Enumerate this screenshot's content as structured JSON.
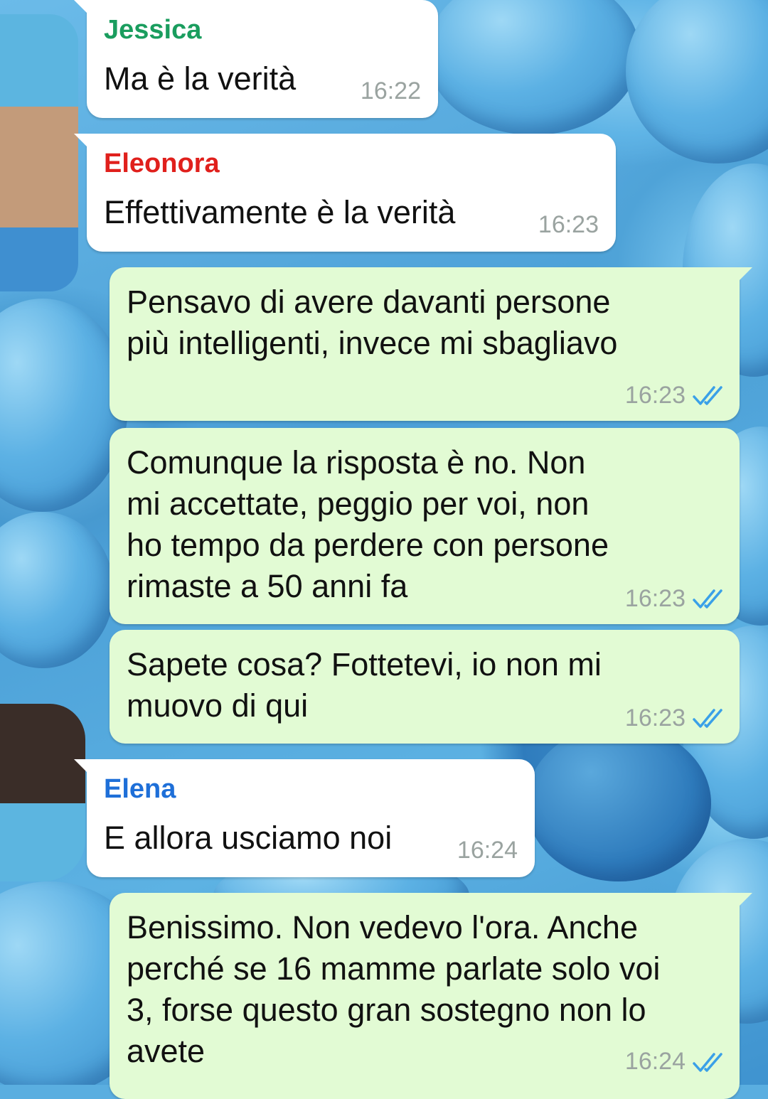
{
  "colors": {
    "incoming_bubble": "#ffffff",
    "outgoing_bubble": "#e2fbd4",
    "read_ticks": "#3aa0e8",
    "jessica": "#1a9d5e",
    "eleonora": "#e0201c",
    "elena": "#1e6fd8"
  },
  "messages": [
    {
      "direction": "incoming",
      "sender": "Jessica",
      "lines": [
        "Ma è la verità"
      ],
      "time": "16:22"
    },
    {
      "direction": "incoming",
      "sender": "Eleonora",
      "lines": [
        "Effettivamente è la verità"
      ],
      "time": "16:23"
    },
    {
      "direction": "outgoing",
      "lines": [
        "Pensavo di avere davanti persone",
        "più intelligenti, invece mi sbagliavo"
      ],
      "time": "16:23",
      "status_icon": "double-check-read-icon"
    },
    {
      "direction": "outgoing",
      "lines": [
        "Comunque la risposta è no. Non",
        "mi accettate, peggio per voi, non",
        "ho tempo da perdere con persone",
        "rimaste a 50 anni fa"
      ],
      "time": "16:23",
      "status_icon": "double-check-read-icon"
    },
    {
      "direction": "outgoing",
      "lines": [
        "Sapete cosa? Fottetevi, io non mi",
        "muovo di qui"
      ],
      "time": "16:23",
      "status_icon": "double-check-read-icon"
    },
    {
      "direction": "incoming",
      "sender": "Elena",
      "lines": [
        "E allora usciamo noi"
      ],
      "time": "16:24"
    },
    {
      "direction": "outgoing",
      "lines": [
        "Benissimo. Non vedevo l'ora. Anche",
        "perché se 16 mamme parlate solo voi",
        "3, forse questo gran sostegno non lo",
        "avete"
      ],
      "time": "16:24",
      "status_icon": "double-check-read-icon"
    }
  ]
}
